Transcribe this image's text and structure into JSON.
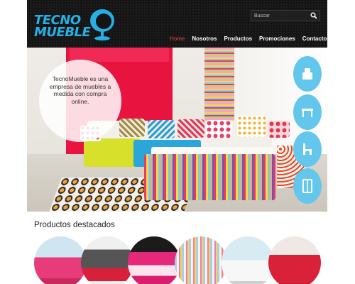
{
  "brand": {
    "line1": "TECNO",
    "line2": "MUEBLE",
    "color": "#27b0e6",
    "icon": "egg-chair-logo-icon"
  },
  "search": {
    "placeholder": "Buscar",
    "icon": "search-icon"
  },
  "nav": {
    "items": [
      {
        "label": "Home",
        "active": true
      },
      {
        "label": "Nosotros",
        "active": false
      },
      {
        "label": "Productos",
        "active": false
      },
      {
        "label": "Promociones",
        "active": false
      },
      {
        "label": "Contacto",
        "active": false
      }
    ],
    "active_color": "#e8453c"
  },
  "hero": {
    "intro": "TecnoMueble es una empresa de muebles a medida con compra online.",
    "side_icons": [
      "bed-icon",
      "table-icon",
      "chair-icon",
      "wardrobe-icon"
    ],
    "tab_color": "#63c6ec"
  },
  "featured": {
    "title": "Productos destacados",
    "items": [
      {
        "icon": "pink-sofa-image"
      },
      {
        "icon": "grey-sofa-image"
      },
      {
        "icon": "pink-bed-image"
      },
      {
        "icon": "striped-curtain-image"
      },
      {
        "icon": "white-chair-image"
      },
      {
        "icon": "red-armchair-image"
      }
    ]
  }
}
